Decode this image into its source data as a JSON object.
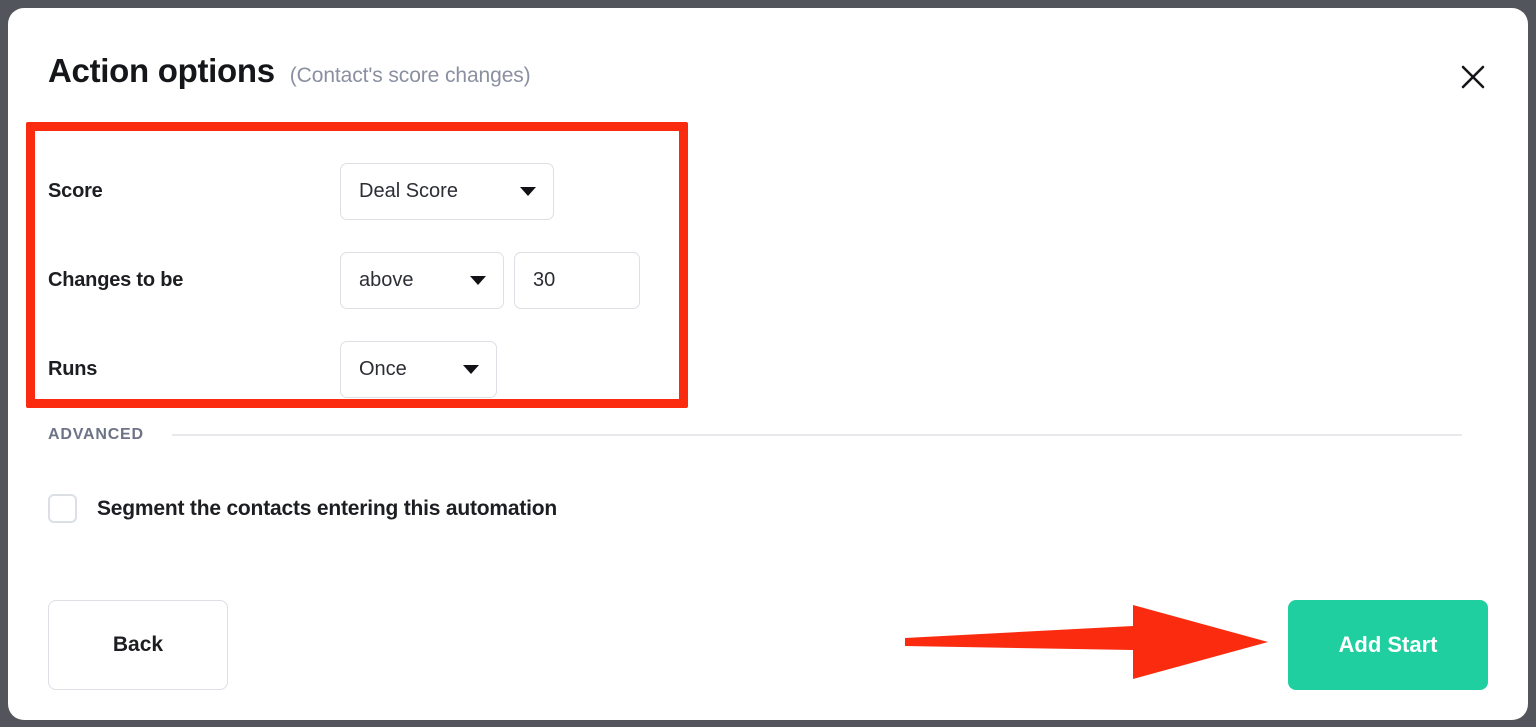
{
  "dialog": {
    "title": "Action options",
    "subtitle": "(Contact's score changes)",
    "close_icon": "close-icon"
  },
  "form": {
    "rows": [
      {
        "label": "Score",
        "control": "select",
        "value": "Deal Score"
      },
      {
        "label": "Changes to be",
        "control": "select-plus-number",
        "value": "above",
        "number_value": "30"
      },
      {
        "label": "Runs",
        "control": "select",
        "value": "Once"
      }
    ]
  },
  "advanced": {
    "section_label": "ADVANCED",
    "segment_checkbox_label": "Segment the contacts entering this automation",
    "segment_checked": false
  },
  "footer": {
    "back_label": "Back",
    "add_start_label": "Add Start"
  },
  "annotations": {
    "highlight_color": "#fa2b0f",
    "arrow_color": "#fa2b0f",
    "accent_color": "#20cfa0"
  }
}
